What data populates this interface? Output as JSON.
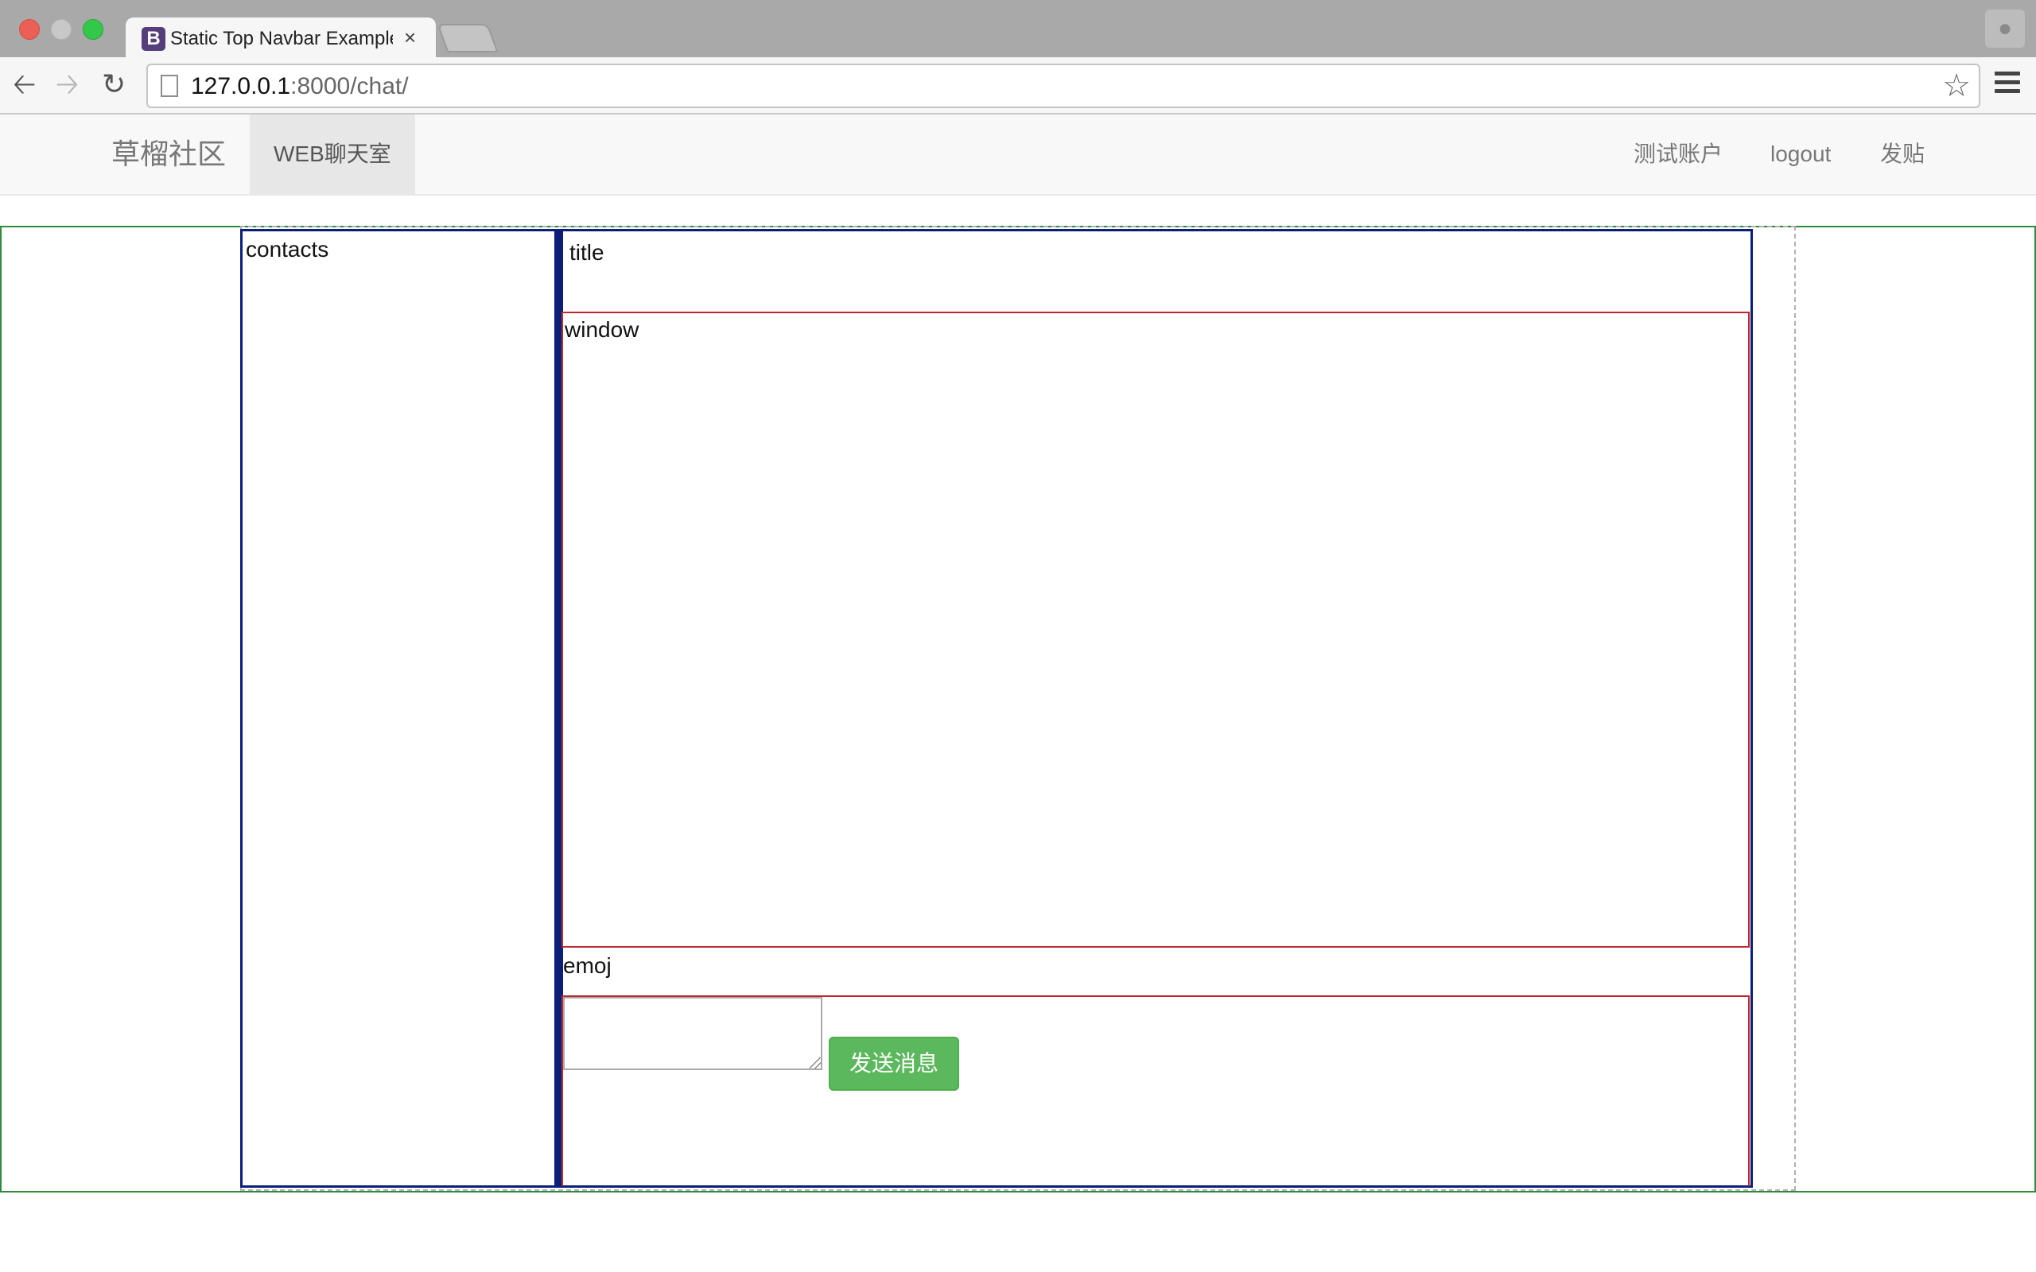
{
  "browser": {
    "tab_favicon": "B",
    "tab_title": "Static Top Navbar Example",
    "tab_close": "×",
    "url_host": "127.0.0.1",
    "url_path": ":8000/chat/",
    "icons": [
      "back-arrow-icon",
      "forward-arrow-icon",
      "reload-icon",
      "page-icon",
      "star-icon",
      "menu-icon",
      "profile-icon"
    ]
  },
  "navbar": {
    "brand": "草榴社区",
    "active_item": "WEB聊天室",
    "right_items": [
      "测试账户",
      "logout",
      "发贴"
    ]
  },
  "chat": {
    "contacts_label": "contacts",
    "title_label": "title",
    "window_label": "window",
    "emoj_label": "emoj",
    "textarea_value": "",
    "send_label": "发送消息"
  },
  "colors": {
    "outer_border": "#2e8b3a",
    "panel_border": "#0b1f7a",
    "section_border": "#c0272d",
    "send_button": "#5cb85c",
    "navbar_bg": "#f8f8f8"
  }
}
